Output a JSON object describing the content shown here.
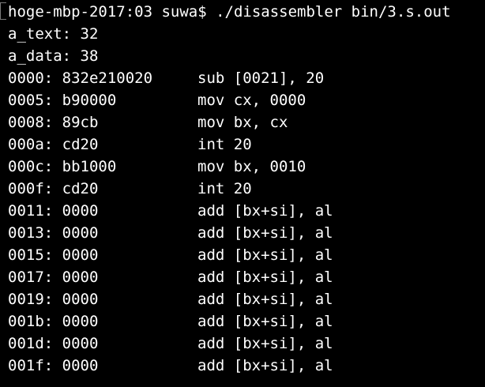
{
  "prompt": {
    "text": "hoge-mbp-2017:03 suwa$ ./disassembler bin/3.s.out"
  },
  "header": [
    "a_text: 32",
    "a_data: 38"
  ],
  "rows": [
    {
      "address": "0000: 832e210020",
      "instruction": "sub [0021], 20"
    },
    {
      "address": "0005: b90000",
      "instruction": "mov cx, 0000"
    },
    {
      "address": "0008: 89cb",
      "instruction": "mov bx, cx"
    },
    {
      "address": "000a: cd20",
      "instruction": "int 20"
    },
    {
      "address": "000c: bb1000",
      "instruction": "mov bx, 0010"
    },
    {
      "address": "000f: cd20",
      "instruction": "int 20"
    },
    {
      "address": "0011: 0000",
      "instruction": "add [bx+si], al"
    },
    {
      "address": "0013: 0000",
      "instruction": "add [bx+si], al"
    },
    {
      "address": "0015: 0000",
      "instruction": "add [bx+si], al"
    },
    {
      "address": "0017: 0000",
      "instruction": "add [bx+si], al"
    },
    {
      "address": "0019: 0000",
      "instruction": "add [bx+si], al"
    },
    {
      "address": "001b: 0000",
      "instruction": "add [bx+si], al"
    },
    {
      "address": "001d: 0000",
      "instruction": "add [bx+si], al"
    },
    {
      "address": "001f: 0000",
      "instruction": "add [bx+si], al"
    }
  ]
}
